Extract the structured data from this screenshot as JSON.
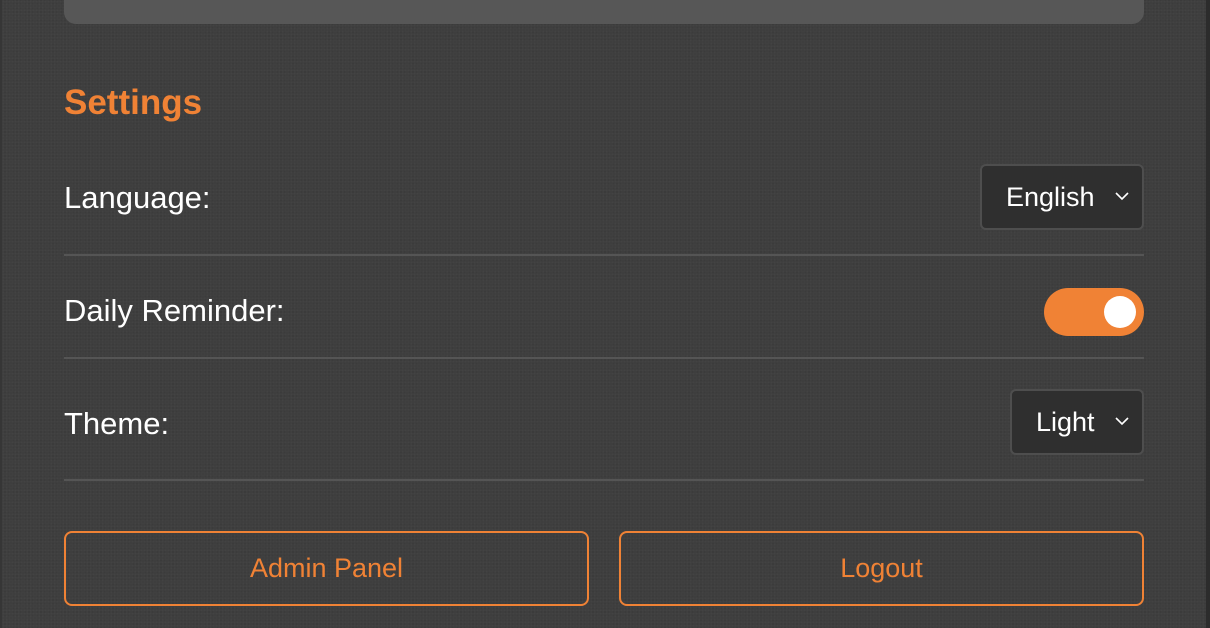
{
  "settings": {
    "title": "Settings",
    "language": {
      "label": "Language:",
      "selected": "English"
    },
    "daily_reminder": {
      "label": "Daily Reminder:",
      "enabled": true
    },
    "theme": {
      "label": "Theme:",
      "selected": "Light"
    }
  },
  "actions": {
    "admin_panel_label": "Admin Panel",
    "logout_label": "Logout"
  },
  "colors": {
    "accent": "#f08235",
    "background": "#3e3e3e",
    "text": "#ffffff"
  },
  "icons": {
    "select_arrow": "chevron-down-icon"
  }
}
